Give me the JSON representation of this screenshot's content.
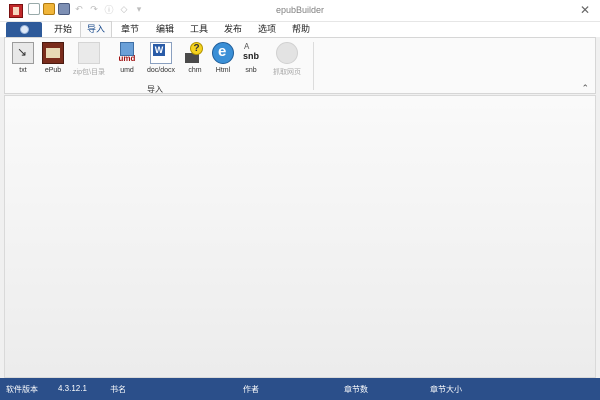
{
  "window": {
    "title": "epubBuilder"
  },
  "quick_access": [
    {
      "icon": "new-file-icon"
    },
    {
      "icon": "open-folder-icon"
    },
    {
      "icon": "save-icon"
    },
    {
      "icon": "undo-icon"
    },
    {
      "icon": "redo-icon"
    },
    {
      "icon": "info-icon"
    },
    {
      "icon": "settings-icon"
    },
    {
      "icon": "dropdown-icon"
    }
  ],
  "tabs": [
    {
      "label": "开始"
    },
    {
      "label": "导入",
      "active": true
    },
    {
      "label": "章节"
    },
    {
      "label": "编辑"
    },
    {
      "label": "工具"
    },
    {
      "label": "发布"
    },
    {
      "label": "选项"
    },
    {
      "label": "帮助"
    }
  ],
  "ribbon": {
    "group_label": "导入",
    "buttons": [
      {
        "label": "txt",
        "icon": "txt-import-icon",
        "enabled": true
      },
      {
        "label": "ePub",
        "icon": "epub-book-icon",
        "enabled": true
      },
      {
        "label": "zip包\\目录",
        "icon": "zip-folder-icon",
        "enabled": false
      },
      {
        "label": "umd",
        "icon": "umd-icon",
        "enabled": true
      },
      {
        "label": "doc/docx",
        "icon": "word-doc-icon",
        "enabled": true
      },
      {
        "label": "chm",
        "icon": "chm-help-icon",
        "enabled": true
      },
      {
        "label": "Html",
        "icon": "html-browser-icon",
        "enabled": true
      },
      {
        "label": "snb",
        "icon": "snb-icon",
        "enabled": true
      },
      {
        "label": "抓取网页",
        "icon": "web-grab-icon",
        "enabled": false
      }
    ]
  },
  "icon_text": {
    "umd": "umd",
    "snb": "snb",
    "chm": "?"
  },
  "statusbar": {
    "version_label": "软件版本",
    "version_value": "4.3.12.1",
    "book_label": "书名",
    "author_label": "作者",
    "chapters_label": "章节数",
    "size_label": "章节大小"
  },
  "colors": {
    "statusbar_bg": "#2b4f8a",
    "file_tab_bg": "#2e5a9a",
    "active_tab_text": "#1f4f8f"
  }
}
